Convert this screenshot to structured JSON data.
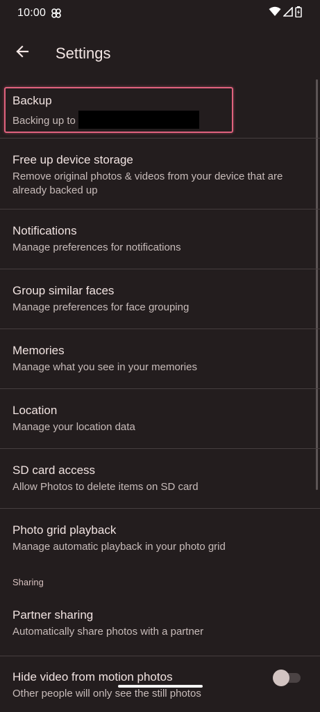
{
  "status_bar": {
    "time": "10:00",
    "icons": [
      "pinwheel-icon",
      "wifi-icon",
      "cell-signal-icon",
      "battery-icon"
    ]
  },
  "header": {
    "title": "Settings",
    "back_icon": "back-arrow-icon"
  },
  "settings": [
    {
      "id": "backup",
      "title": "Backup",
      "subtitle": "Backing up to",
      "redacted": true,
      "highlighted": true
    },
    {
      "id": "free-up-storage",
      "title": "Free up device storage",
      "subtitle": "Remove original photos & videos from your device that are already backed up"
    },
    {
      "id": "notifications",
      "title": "Notifications",
      "subtitle": "Manage preferences for notifications"
    },
    {
      "id": "group-similar-faces",
      "title": "Group similar faces",
      "subtitle": "Manage preferences for face grouping"
    },
    {
      "id": "memories",
      "title": "Memories",
      "subtitle": "Manage what you see in your memories"
    },
    {
      "id": "location",
      "title": "Location",
      "subtitle": "Manage your location data"
    },
    {
      "id": "sd-card-access",
      "title": "SD card access",
      "subtitle": "Allow Photos to delete items on SD card"
    },
    {
      "id": "photo-grid-playback",
      "title": "Photo grid playback",
      "subtitle": "Manage automatic playback in your photo grid"
    }
  ],
  "sharing_section": {
    "header": "Sharing",
    "items": [
      {
        "id": "partner-sharing",
        "title": "Partner sharing",
        "subtitle": "Automatically share photos with a partner"
      },
      {
        "id": "hide-video-motion",
        "title": "Hide video from motion photos",
        "subtitle": "Other people will only see the still photos",
        "toggle": true,
        "toggle_on": false
      }
    ]
  },
  "colors": {
    "background": "#231d1e",
    "highlight": "#e0627e",
    "divider": "#463e3f"
  }
}
